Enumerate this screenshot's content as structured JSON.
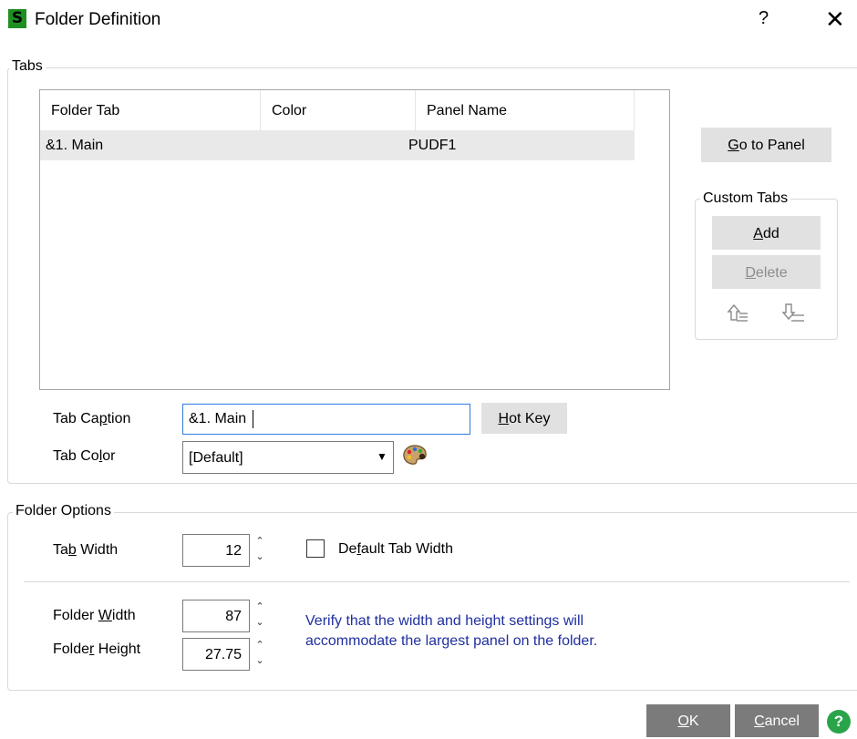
{
  "window": {
    "app_icon_letter": "S",
    "title": "Folder Definition",
    "help_label": "?",
    "close_label": "✕"
  },
  "tabs_group": {
    "label": "Tabs",
    "columns": [
      "Folder Tab",
      "Color",
      "Panel Name"
    ],
    "rows": [
      {
        "folder_tab": "&1. Main",
        "color": "",
        "panel_name": "PUDF1"
      }
    ],
    "go_to_panel_prefix": "G",
    "go_to_panel_rest": "o to Panel"
  },
  "custom_tabs": {
    "label": "Custom Tabs",
    "add_prefix": "A",
    "add_rest": "dd",
    "delete_prefix": "D",
    "delete_rest": "elete",
    "move_up_icon": "move-up-icon",
    "move_down_icon": "move-down-icon"
  },
  "tab_caption": {
    "label_a": "Tab Ca",
    "label_u": "p",
    "label_b": "tion",
    "value": "&1. Main",
    "hot_key_prefix": "H",
    "hot_key_rest": "ot Key"
  },
  "tab_color": {
    "label_a": "Tab Co",
    "label_u": "l",
    "label_b": "or",
    "value": "[Default]",
    "palette_icon": "palette-icon"
  },
  "folder_options": {
    "label": "Folder Options",
    "tab_width_label_a": "Ta",
    "tab_width_label_u": "b",
    "tab_width_label_b": " Width",
    "tab_width_value": "12",
    "default_tab_width_label_a": "De",
    "default_tab_width_label_u": "f",
    "default_tab_width_label_b": "ault Tab Width",
    "default_tab_width_checked": false,
    "folder_width_label_a": "Folder ",
    "folder_width_label_u": "W",
    "folder_width_label_b": "idth",
    "folder_width_value": "87",
    "folder_height_label_a": "Folde",
    "folder_height_label_u": "r",
    "folder_height_label_b": " Height",
    "folder_height_value": "27.75",
    "note_line1": "Verify that the width and height settings will",
    "note_line2": "accommodate the largest panel on the folder."
  },
  "footer": {
    "ok_prefix": "O",
    "ok_rest": "K",
    "cancel_prefix": "C",
    "cancel_rest": "ancel",
    "help_icon": "help-circle-icon",
    "help_glyph": "?"
  },
  "colors": {
    "accent_green": "#1f8f22",
    "note_blue": "#1f2fa0",
    "button_gray": "#e1e1e1",
    "dark_button": "#7b7b7b",
    "help_green": "#2aa44a"
  }
}
